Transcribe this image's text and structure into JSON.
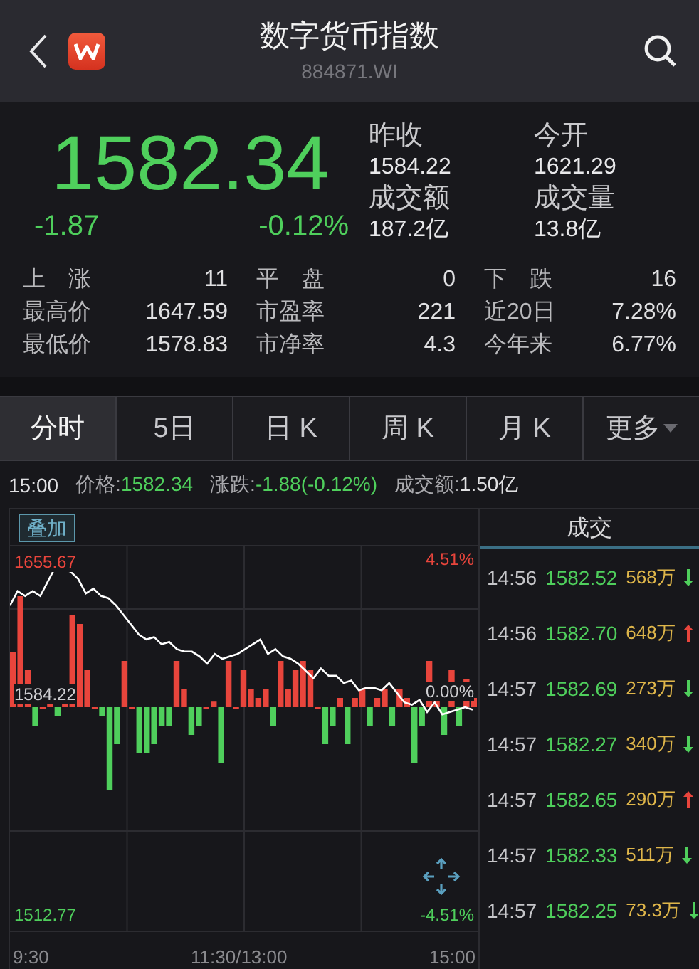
{
  "header": {
    "title": "数字货币指数",
    "code": "884871.WI"
  },
  "quote": {
    "price": "1582.34",
    "change": "-1.87",
    "change_pct": "-0.12%",
    "stats": [
      {
        "label": "昨收",
        "value": "1584.22"
      },
      {
        "label": "今开",
        "value": "1621.29"
      },
      {
        "label": "成交额",
        "value": "187.2亿"
      },
      {
        "label": "成交量",
        "value": "13.8亿"
      }
    ]
  },
  "breadth": [
    {
      "label": "上　涨",
      "value": "11"
    },
    {
      "label": "平　盘",
      "value": "0"
    },
    {
      "label": "下　跌",
      "value": "16"
    },
    {
      "label": "最高价",
      "value": "1647.59"
    },
    {
      "label": "市盈率",
      "value": "221"
    },
    {
      "label": "近20日",
      "value": "7.28%"
    },
    {
      "label": "最低价",
      "value": "1578.83"
    },
    {
      "label": "市净率",
      "value": "4.3"
    },
    {
      "label": "今年来",
      "value": "6.77%"
    }
  ],
  "tabs": [
    {
      "label": "分时",
      "selected": true,
      "kind": "tab"
    },
    {
      "label": "5日",
      "selected": false,
      "kind": "tab"
    },
    {
      "label": "日 K",
      "selected": false,
      "kind": "tab"
    },
    {
      "label": "周 K",
      "selected": false,
      "kind": "tab"
    },
    {
      "label": "月 K",
      "selected": false,
      "kind": "tab"
    },
    {
      "label": "更多",
      "selected": false,
      "kind": "menu"
    }
  ],
  "info_line": {
    "time": "15:00",
    "items": [
      {
        "label": "价格:",
        "value": "1582.34",
        "color": "#4fcf5c"
      },
      {
        "label": "涨跌:",
        "value": "-1.88(-0.12%)",
        "color": "#4fcf5c"
      },
      {
        "label": "成交额:",
        "value": "1.50亿",
        "color": "#e0e0e2"
      }
    ]
  },
  "chart": {
    "overlay_button": "叠加",
    "high": "1655.67",
    "high_pct": "4.51%",
    "base": "1584.22",
    "base_pct": "0.00%",
    "low": "1512.77",
    "low_pct": "-4.51%",
    "time_ticks": [
      "9:30",
      "11:30/13:00",
      "15:00"
    ]
  },
  "trades": {
    "title": "成交",
    "rows": [
      {
        "time": "14:56",
        "price": "1582.52",
        "volume": "568万",
        "rising": false
      },
      {
        "time": "14:56",
        "price": "1582.70",
        "volume": "648万",
        "rising": true
      },
      {
        "time": "14:57",
        "price": "1582.69",
        "volume": "273万",
        "rising": false
      },
      {
        "time": "14:57",
        "price": "1582.27",
        "volume": "340万",
        "rising": false
      },
      {
        "time": "14:57",
        "price": "1582.65",
        "volume": "290万",
        "rising": true
      },
      {
        "time": "14:57",
        "price": "1582.33",
        "volume": "511万",
        "rising": false
      },
      {
        "time": "14:57",
        "price": "1582.25",
        "volume": "73.3万",
        "rising": false
      }
    ]
  }
}
